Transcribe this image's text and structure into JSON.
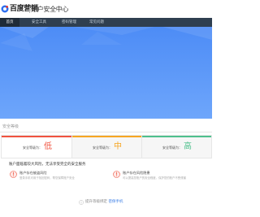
{
  "header": {
    "brand": "百度营销",
    "title": "账户安全中心"
  },
  "nav": {
    "items": [
      {
        "label": "首页",
        "active": true
      },
      {
        "label": "安全工具",
        "active": false
      },
      {
        "label": "密码管理",
        "active": false
      },
      {
        "label": "常见问题",
        "active": false
      }
    ]
  },
  "security": {
    "section_title": "安全等级",
    "levels": [
      {
        "label": "安全等级为：",
        "value": "低",
        "color": "#f0533f"
      },
      {
        "label": "安全等级为：",
        "value": "中",
        "color": "#f6a623"
      },
      {
        "label": "安全等级为：",
        "value": "高",
        "color": "#4fc08d"
      }
    ],
    "tip": "账户面临着较大风险，无法享受完全的安全服务",
    "risks": [
      {
        "title": "账户存在被盗风险",
        "desc": "登录手机可用于找回密码，帮您保障账户安全",
        "icon": "shield-alert-icon"
      },
      {
        "title": "账户存在风险隐患",
        "desc": "可以提高您账户的安全程度，保护您的账户不受侵害",
        "icon": "shield-alert-icon"
      }
    ],
    "upgrade": {
      "text": "提升等级绑定",
      "link": "密保手机"
    }
  },
  "colors": {
    "nav_bg": "#2f3f50",
    "banner": "#4d8cf6",
    "link": "#3d7fe6"
  }
}
